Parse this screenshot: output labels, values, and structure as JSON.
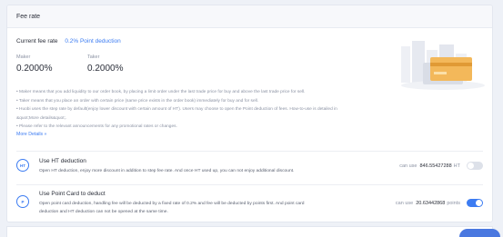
{
  "header": {
    "title": "Fee rate"
  },
  "current_fee": {
    "label": "Current fee rate",
    "value": "0.2% Point deduction"
  },
  "maker": {
    "label": "Maker",
    "value": "0.2000%"
  },
  "taker": {
    "label": "Taker",
    "value": "0.2000%"
  },
  "notes": [
    "• Maker means that you add liquidity to our order book, by placing a limit order under the last trade price for buy and above the last trade price for sell.",
    "• Taker means that you place an order with certain price (same price exists in the order book) immediately for buy and for sell.",
    "• Huobi uses the step rate by default(enjoy lower discount with certain amount of HT). Users may choose to open the Point deduction of fees. How-to-use is detailed in",
    "  &quot;More details&quot;.",
    "• Please refer to the relevant announcements for any promotional rates or changes."
  ],
  "more_details": "More Details »",
  "options": {
    "ht": {
      "icon_text": "HT",
      "title": "Use HT deduction",
      "desc": "Open HT deduction, enjoy more discount in addition to step fee rate. And once HT used up, you can not enjoy additional discount.",
      "pre": "can use",
      "amount": "846.55427288",
      "unit": "HT",
      "enabled": false
    },
    "point_card": {
      "icon_text": "P",
      "title": "Use Point Card to deduct",
      "desc_line1": "Open point card deduction, handling fee will be deducted by a fixed rate of 0.2% and fee will be deducted by points first. And point card",
      "desc_line2": "deduction and HT deduction can not be opened at the same time.",
      "pre": "can use",
      "amount": "20.63442868",
      "unit": "points",
      "enabled": true
    }
  },
  "colors": {
    "accent": "#3c7cf2",
    "background": "#eef1f7",
    "muted": "#8b92a3"
  },
  "icons": {
    "ht": "ht-coin-icon",
    "point_card": "point-card-icon",
    "illustration": "cards-illustration"
  }
}
